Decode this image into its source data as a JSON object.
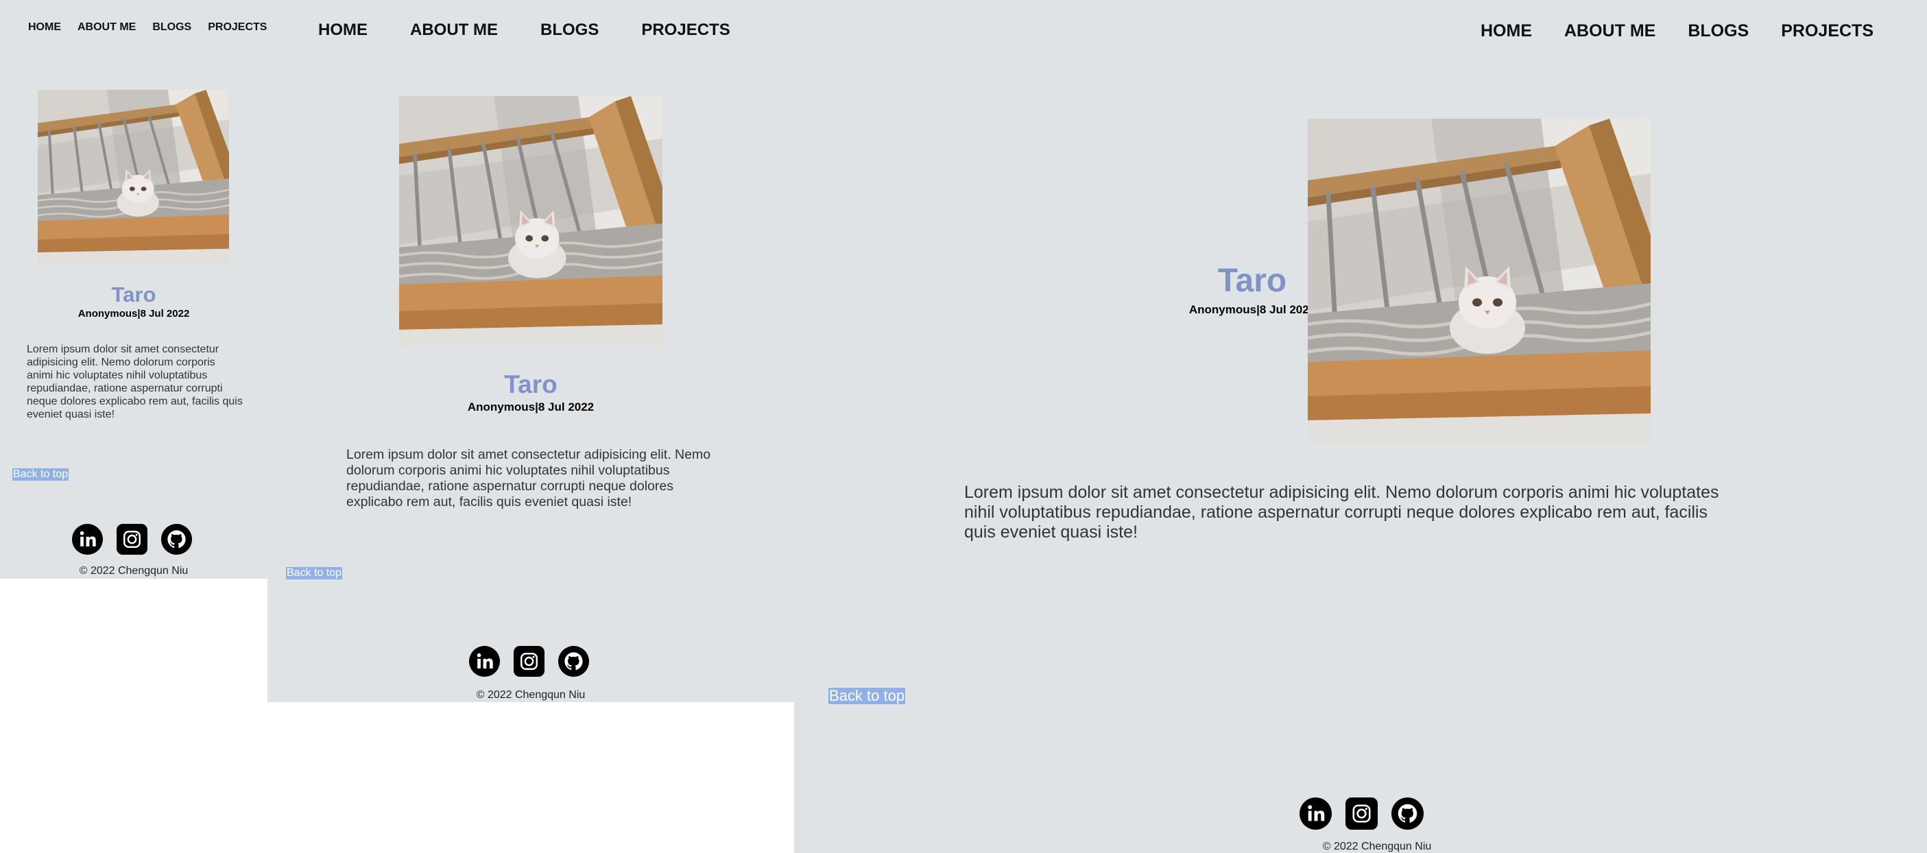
{
  "nav": {
    "home": "HOME",
    "about": "ABOUT ME",
    "blogs": "BLOGS",
    "projects": "PROJECTS"
  },
  "post": {
    "title": "Taro",
    "author": "Anonymous",
    "separator": "|",
    "date": "8 Jul 2022",
    "body": "Lorem ipsum dolor sit amet consectetur adipisicing elit. Nemo dolorum corporis animi hic voluptates nihil voluptatibus repudiandae, ratione aspernatur corrupti neque dolores explicabo rem aut, facilis quis eveniet quasi iste!"
  },
  "footer": {
    "back_to_top": "Back to top",
    "copyright": "© 2022 Chengqun Niu",
    "socials": [
      "linkedin-icon",
      "instagram-icon",
      "github-icon"
    ]
  },
  "colors": {
    "background": "#e0e3e5",
    "title": "#7f93c6",
    "back_to_top_bg": "#8fb1e6"
  }
}
